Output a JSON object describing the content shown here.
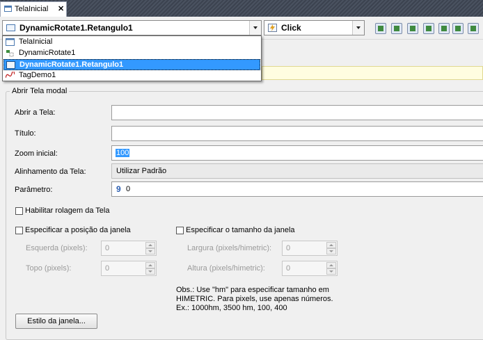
{
  "tab": {
    "title": "TelaInicial",
    "close": "✕"
  },
  "toolbar": {
    "object_value": "DynamicRotate1.Retangulo1",
    "event_value": "Click"
  },
  "object_list": [
    {
      "label": "TelaInicial",
      "icon": "window-icon"
    },
    {
      "label": "DynamicRotate1",
      "icon": "dynamic-rotate-icon"
    },
    {
      "label": "DynamicRotate1.Retangulo1",
      "icon": "rectangle-icon",
      "selected": true
    },
    {
      "label": "TagDemo1",
      "icon": "tag-wave-icon"
    }
  ],
  "group": {
    "title": "Abrir Tela modal"
  },
  "form": {
    "abrir_label": "Abrir a Tela:",
    "abrir_value": "",
    "titulo_label": "Título:",
    "titulo_value": "",
    "zoom_label": "Zoom inicial:",
    "zoom_value": "100",
    "alinhamento_label": "Alinhamento da Tela:",
    "alinhamento_value": "Utilizar Padrão",
    "parametro_label": "Parâmetro:",
    "parametro_icon": "9",
    "parametro_value": "0",
    "rolagem_label": "Habilitar rolagem da Tela",
    "posicao_label": "Especificar a posição da janela",
    "tamanho_label": "Especificar o tamanho da janela",
    "esquerda_label": "Esquerda (pixels):",
    "esquerda_value": "0",
    "topo_label": "Topo (pixels):",
    "topo_value": "0",
    "largura_label": "Largura (pixels/himetric):",
    "largura_value": "0",
    "altura_label": "Altura (pixels/himetric):",
    "altura_value": "0",
    "obs_line1": "Obs.: Use \"hm\" para especificar tamanho em",
    "obs_line2": "HIMETRIC. Para pixels, use apenas números.",
    "obs_line3": "Ex.: 1000hm, 3500 hm, 100, 400",
    "estilo_button": "Estilo da janela..."
  },
  "colors": {
    "selection": "#3399ff",
    "tabstrip": "#4a5260"
  }
}
